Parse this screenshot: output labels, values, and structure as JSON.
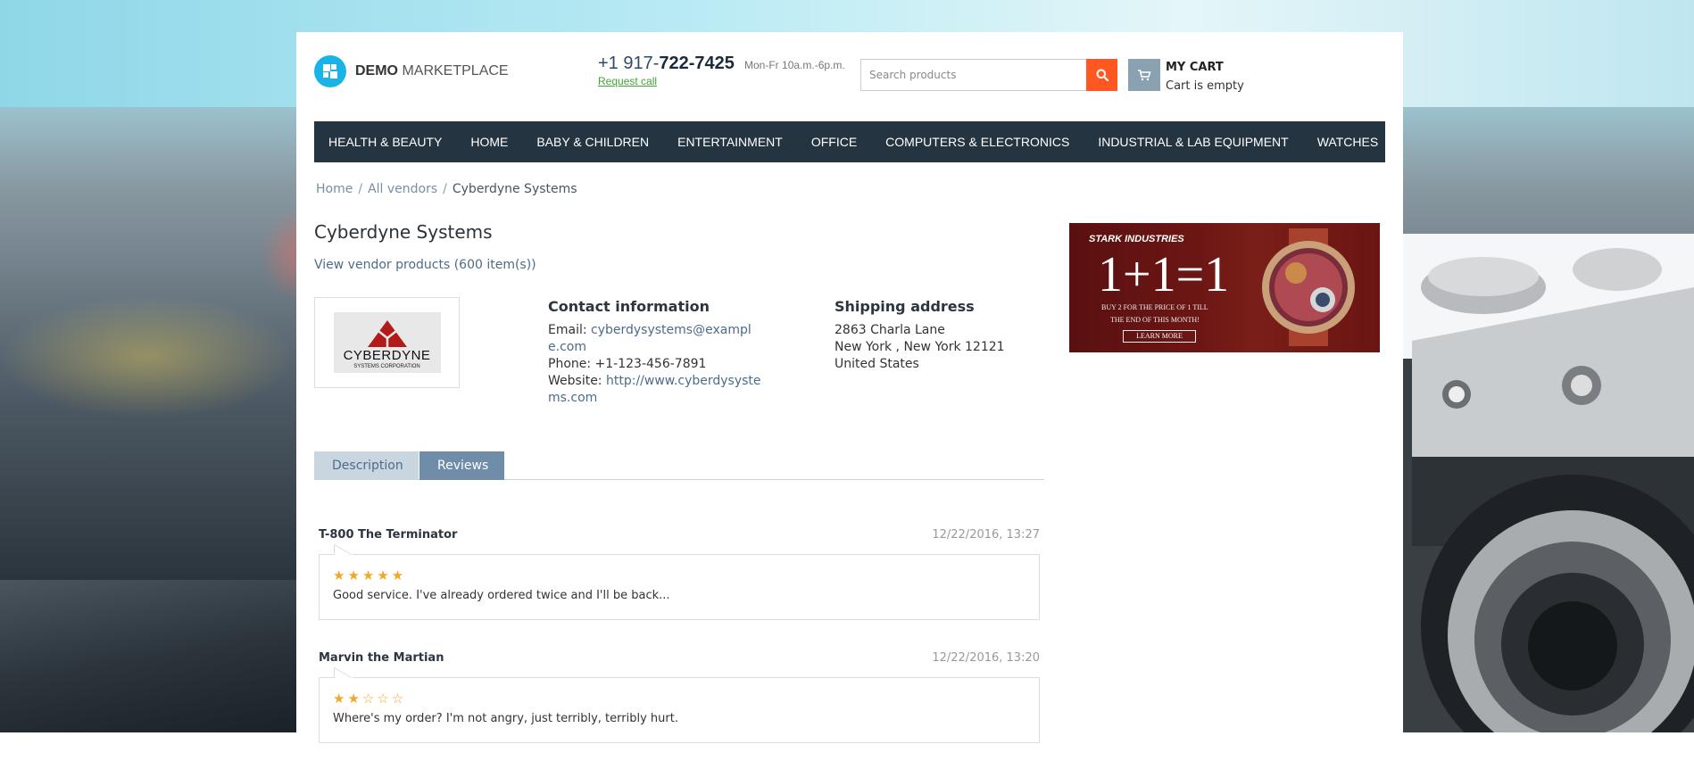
{
  "header": {
    "logo_bold": "DEMO",
    "logo_light": "MARKETPLACE",
    "phone_prefix": "+1 917-",
    "phone_main": "722-7425",
    "phone_hours": "Mon-Fr 10a.m.-6p.m.",
    "request_call": "Request call",
    "search_placeholder": "Search products",
    "cart_title": "MY CART",
    "cart_status": "Cart is empty"
  },
  "nav": {
    "items": [
      "HEALTH & BEAUTY",
      "HOME",
      "BABY & CHILDREN",
      "ENTERTAINMENT",
      "OFFICE",
      "COMPUTERS & ELECTRONICS",
      "INDUSTRIAL & LAB EQUIPMENT",
      "WATCHES"
    ]
  },
  "breadcrumb": {
    "home": "Home",
    "sep": "/",
    "all_vendors": "All vendors",
    "current": "Cyberdyne Systems"
  },
  "vendor": {
    "name": "Cyberdyne Systems",
    "products_link": "View vendor products (600 item(s))",
    "logo_name": "CYBERDYNE",
    "logo_sub": "SYSTEMS CORPORATION"
  },
  "contact": {
    "title": "Contact information",
    "email_label": "Email: ",
    "email": "cyberdysystems@example.com",
    "phone_label": "Phone: ",
    "phone": "+1-123-456-7891",
    "website_label": "Website: ",
    "website": "http://www.cyberdysystems.com"
  },
  "shipping": {
    "title": "Shipping address",
    "line1": "2863 Charla Lane",
    "line2": "New York , New York 12121",
    "line3": "United States"
  },
  "tabs": {
    "description": "Description",
    "reviews": "Reviews",
    "active": "Reviews"
  },
  "reviews": [
    {
      "author": "T-800 The Terminator",
      "date": "12/22/2016, 13:27",
      "rating": 5,
      "stars": "★★★★★",
      "text": "Good service. I've already ordered twice and I'll be back..."
    },
    {
      "author": "Marvin the Martian",
      "date": "12/22/2016, 13:20",
      "rating": 2,
      "stars": "★★☆☆☆",
      "text": "Where's my order? I'm not angry, just terribly, terribly hurt."
    }
  ],
  "banner": {
    "brand": "STARK INDUSTRIES",
    "headline": "1+1=1",
    "line1": "BUY 2 FOR THE PRICE OF 1 TILL",
    "line2": "THE END OF THIS MONTH!",
    "button": "LEARN MORE"
  },
  "colors": {
    "nav_bg": "#253441",
    "search_btn": "#ff5722",
    "logo": "#1ab3e6",
    "tab_active": "#6f8ca9",
    "star": "#f5a623",
    "link": "#4b6c8a"
  }
}
